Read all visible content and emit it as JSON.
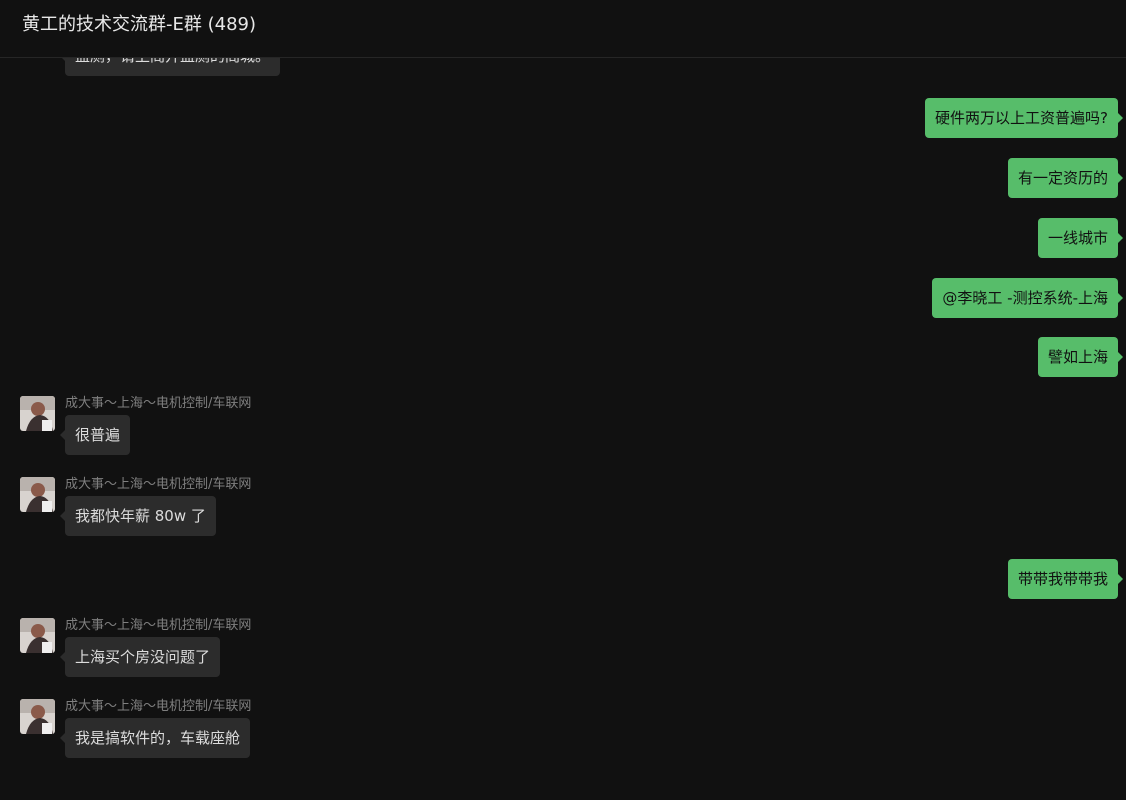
{
  "header": {
    "title": "黄工的技术交流群-E群 (489)"
  },
  "messages": {
    "top_partial": {
      "text": "盖厕，请上阁开盖厕的阁城。"
    },
    "m1": {
      "text": "硬件两万以上工资普遍吗?"
    },
    "m2": {
      "text": "有一定资历的"
    },
    "m3": {
      "text": "一线城市"
    },
    "m4": {
      "text": "@李晓工 -测控系统-上海"
    },
    "m5": {
      "text": "譬如上海"
    },
    "m6": {
      "sender": "成大事～上海～电机控制/车联网",
      "text": "很普遍"
    },
    "m7": {
      "sender": "成大事～上海～电机控制/车联网",
      "text": "我都快年薪 80w 了"
    },
    "m8": {
      "text": "带带我带带我"
    },
    "m9": {
      "sender": "成大事～上海～电机控制/车联网",
      "text": "上海买个房没问题了"
    },
    "m10": {
      "sender": "成大事～上海～电机控制/车联网",
      "text": "我是搞软件的，车载座舱"
    }
  },
  "colors": {
    "background": "#111111",
    "outgoing_bubble": "#57bd6a",
    "incoming_bubble": "#2c2c2c",
    "sender_text": "#7f7f7f"
  }
}
